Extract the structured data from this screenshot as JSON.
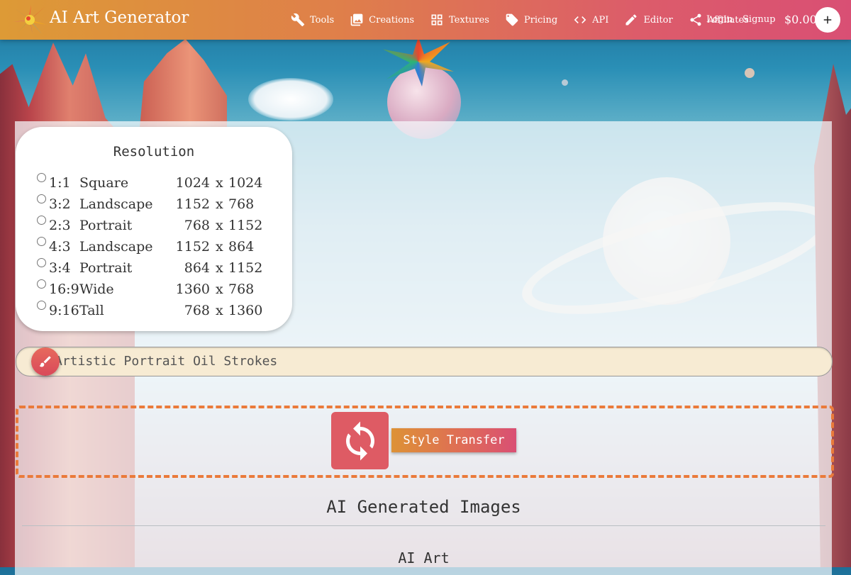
{
  "header": {
    "brand": "AI Art Generator",
    "nav": [
      {
        "label": "Tools",
        "icon": "wrench-icon"
      },
      {
        "label": "Creations",
        "icon": "image-icon"
      },
      {
        "label": "Textures",
        "icon": "grid-icon"
      },
      {
        "label": "Pricing",
        "icon": "tag-icon"
      },
      {
        "label": "API",
        "icon": "code-icon"
      },
      {
        "label": "Editor",
        "icon": "pencil-icon"
      },
      {
        "label": "Affiliates",
        "icon": "share-icon"
      }
    ],
    "login": "Login",
    "signup": "Signup",
    "balance": "$0.00"
  },
  "resolution": {
    "title": "Resolution",
    "options": [
      {
        "ratio": "1:1",
        "name": "Square",
        "width": "1024",
        "x": "x",
        "height": "1024"
      },
      {
        "ratio": "3:2",
        "name": "Landscape",
        "width": "1152",
        "x": "x",
        "height": "768"
      },
      {
        "ratio": "2:3",
        "name": "Portrait",
        "width": "768",
        "x": "x",
        "height": "1152"
      },
      {
        "ratio": "4:3",
        "name": "Landscape",
        "width": "1152",
        "x": "x",
        "height": "864"
      },
      {
        "ratio": "3:4",
        "name": "Portrait",
        "width": "864",
        "x": "x",
        "height": "1152"
      },
      {
        "ratio": "16:9",
        "name": "Wide",
        "width": "1360",
        "x": "x",
        "height": "768"
      },
      {
        "ratio": "9:16",
        "name": "Tall",
        "width": "768",
        "x": "x",
        "height": "1360"
      }
    ]
  },
  "prompt": {
    "value": "Artistic Portrait Oil Strokes"
  },
  "actions": {
    "style_transfer": "Style Transfer"
  },
  "gallery": {
    "title": "AI Generated Images",
    "subtitle": "AI Art"
  },
  "colors": {
    "header_start": "#dd9a36",
    "header_end": "#d94f74",
    "accent_red": "#de5b64",
    "dashed_border": "#ea7a3a"
  }
}
